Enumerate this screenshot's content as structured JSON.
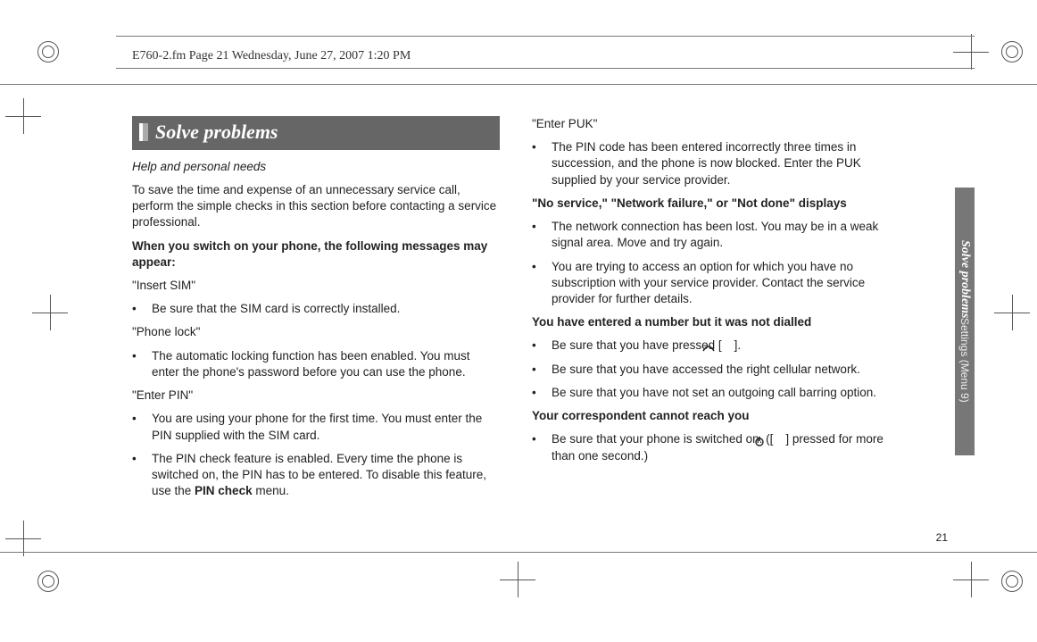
{
  "header": {
    "framemaker_line": "E760-2.fm  Page 21  Wednesday, June 27, 2007  1:20 PM"
  },
  "side_tab": {
    "bold_part": "Solve problems",
    "rest": "    Settings (Menu 9)"
  },
  "page_number": "21",
  "section": {
    "title": "Solve problems",
    "subtitle": "Help and personal needs",
    "intro": "To save the time and expense of an unnecessary service call, perform the simple checks in this section before contacting a service professional.",
    "heading1": "When you switch on your phone, the following messages may appear:",
    "insert_sim_label": "\"Insert SIM\"",
    "insert_sim_bullet": "Be sure that the SIM card is correctly installed.",
    "phone_lock_label": "\"Phone lock\"",
    "phone_lock_bullet": "The automatic locking function has been enabled. You must enter the phone's password before you can use the phone.",
    "enter_pin_label": "\"Enter PIN\"",
    "enter_pin_bullet1": "You are using your phone for the first time. You must enter the PIN supplied with the SIM card.",
    "enter_pin_bullet2_pre": "The PIN check feature is enabled. Every time the phone is switched on, the PIN has to be entered. To disable this feature, use the ",
    "enter_pin_bullet2_bold": "PIN check",
    "enter_pin_bullet2_post": " menu.",
    "enter_puk_label": "\"Enter PUK\"",
    "enter_puk_bullet": "The PIN code has been entered incorrectly three times in succession, and the phone is now blocked. Enter the PUK supplied by your service provider.",
    "no_service_heading": "\"No service,\" \"Network failure,\" or \"Not done\" displays",
    "no_service_bullet1": "The network connection has been lost. You may be in a weak signal area. Move and try again.",
    "no_service_bullet2": "You are trying to access an option for which you have no subscription with your service provider. Contact the service provider for further details.",
    "not_dialled_heading": "You have entered a number but it was not dialled",
    "not_dialled_b1_pre": "Be sure that you have pressed [",
    "not_dialled_b1_post": "].",
    "not_dialled_b2": "Be sure that you have accessed the right cellular network.",
    "not_dialled_b3": "Be sure that you have not set an outgoing call barring option.",
    "cannot_reach_heading": "Your correspondent cannot reach you",
    "cannot_reach_b1_pre": "Be sure that your phone is switched on. ([",
    "cannot_reach_b1_post": "] pressed for more than one second.)"
  }
}
